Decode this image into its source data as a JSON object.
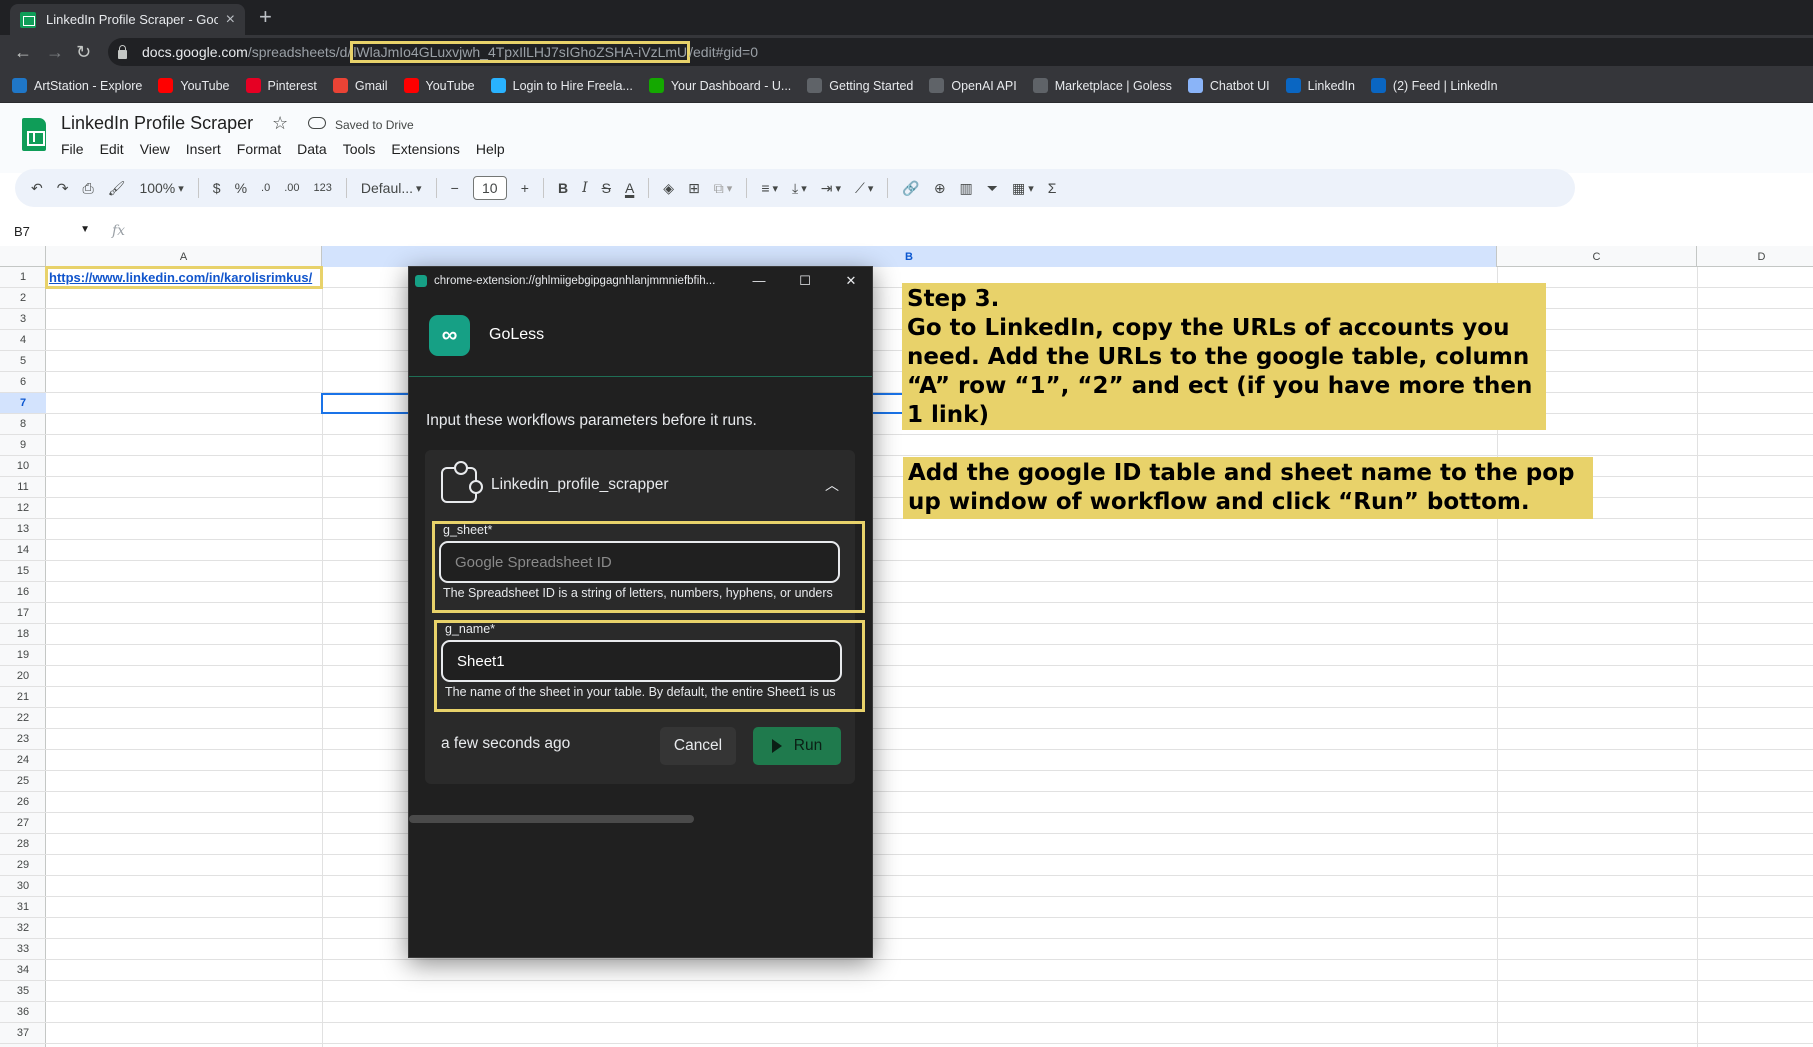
{
  "browser": {
    "tab_title": "LinkedIn Profile Scraper - Google Sheets",
    "new_tab": "+",
    "url_host": "docs.google.com",
    "url_path": "/spreadsheets/d/",
    "url_id": "lWlaJmIo4GLuxvjwh_4TpxIlLHJ7sIGhoZSHA-iVzLmU",
    "url_rest": "/edit#gid=0",
    "bookmarks": [
      {
        "label": "ArtStation - Explore",
        "icon": "artstation-icon",
        "color": "#1f77c8"
      },
      {
        "label": "YouTube",
        "icon": "youtube-icon",
        "color": "#ff0000"
      },
      {
        "label": "Pinterest",
        "icon": "pinterest-icon",
        "color": "#e60023"
      },
      {
        "label": "Gmail",
        "icon": "gmail-icon",
        "color": "#ea4335"
      },
      {
        "label": "YouTube",
        "icon": "youtube-icon",
        "color": "#ff0000"
      },
      {
        "label": "Login to Hire Freela...",
        "icon": "freelancer-icon",
        "color": "#29b2fe"
      },
      {
        "label": "Your Dashboard - U...",
        "icon": "upwork-icon",
        "color": "#14a800"
      },
      {
        "label": "Getting Started",
        "icon": "notion-icon",
        "color": "#5f6368"
      },
      {
        "label": "OpenAI API",
        "icon": "openai-icon",
        "color": "#5f6368"
      },
      {
        "label": "Marketplace | Goless",
        "icon": "goless-icon",
        "color": "#5f6368"
      },
      {
        "label": "Chatbot UI",
        "icon": "chat-bubble-icon",
        "color": "#8ab4f8"
      },
      {
        "label": "LinkedIn",
        "icon": "linkedin-icon",
        "color": "#0a66c2"
      },
      {
        "label": "(2) Feed | LinkedIn",
        "icon": "linkedin-icon",
        "color": "#0a66c2"
      }
    ]
  },
  "sheets": {
    "title": "LinkedIn Profile Scraper",
    "saved_status": "Saved to Drive",
    "menus": [
      "File",
      "Edit",
      "View",
      "Insert",
      "Format",
      "Data",
      "Tools",
      "Extensions",
      "Help"
    ],
    "toolbar": {
      "zoom": "100%",
      "currency": "$",
      "percent": "%",
      "dec_decrease": ".0",
      "dec_increase": ".00",
      "number_format": "123",
      "font": "Defaul...",
      "font_size": "10",
      "minus": "−",
      "plus": "+",
      "bold": "B",
      "italic": "I",
      "strike": "S",
      "text_color": "A",
      "sum": "Σ"
    },
    "name_box": "B7",
    "fx": "fx",
    "columns": [
      "A",
      "B",
      "C",
      "D"
    ],
    "rows": [
      "1",
      "2",
      "3",
      "4",
      "5",
      "6",
      "7",
      "8",
      "9",
      "10",
      "11",
      "12",
      "13",
      "14",
      "15",
      "16",
      "17",
      "18",
      "19",
      "20",
      "21",
      "22",
      "23",
      "24",
      "25",
      "26",
      "27",
      "28",
      "29",
      "30",
      "31",
      "32",
      "33",
      "34",
      "35",
      "36",
      "37"
    ],
    "cell_a1": "https://www.linkedin.com/in/karolisrimkus/"
  },
  "annotations": {
    "note1": "Step 3.\nGo to LinkedIn, copy the URLs of accounts you need. Add the URLs to the google table, column “A” row “1”, “2” and ect (if you have more then 1 link)",
    "note2": "Add the google ID table and sheet name to the pop up window of workflow and click “Run” bottom."
  },
  "popup": {
    "url": "chrome-extension://ghlmiigebgipgagnhlanjmmniefbfih...",
    "brand": "GoLess",
    "intro": "Input these workflows parameters before it runs.",
    "workflow_name": "Linkedin_profile_scrapper",
    "fields": {
      "g_sheet": {
        "label": "g_sheet*",
        "placeholder": "Google Spreadsheet ID",
        "value": "",
        "help": "The Spreadsheet ID is a string of letters, numbers, hyphens, or unders"
      },
      "g_name": {
        "label": "g_name*",
        "value": "Sheet1",
        "help": "The name of the sheet in your table. By default, the entire Sheet1 is us"
      }
    },
    "last_run": "a few seconds ago",
    "cancel_label": "Cancel",
    "run_label": "Run"
  },
  "colors": {
    "highlight": "#e8d26a",
    "sheets_green": "#0f9d58",
    "run_green": "#1f7a4d",
    "selection_blue": "#1a73e8"
  }
}
